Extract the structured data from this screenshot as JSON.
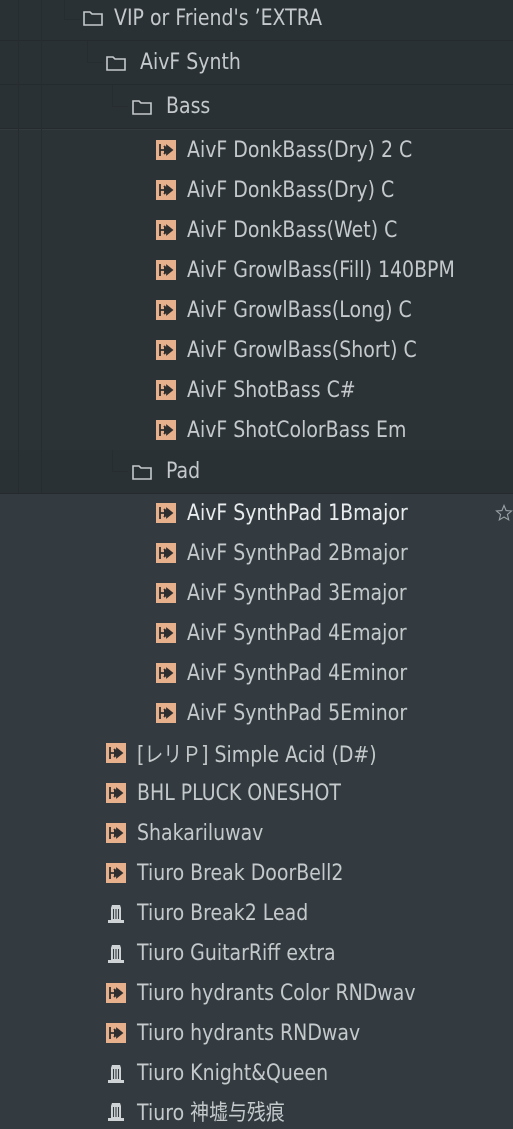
{
  "tree": {
    "folders": {
      "vip": "VIP or Friend's ’EXTRA",
      "aivf_synth": "AivF Synth",
      "bass": "Bass",
      "pad": "Pad"
    },
    "bass_items": [
      "AivF DonkBass(Dry) 2 C",
      "AivF DonkBass(Dry) C",
      "AivF DonkBass(Wet) C",
      "AivF GrowlBass(Fill) 140BPM",
      "AivF GrowlBass(Long) C",
      "AivF GrowlBass(Short) C",
      "AivF ShotBass  C#",
      "AivF ShotColorBass  Em"
    ],
    "pad_items": [
      "AivF SynthPad 1Bmajor",
      "AivF SynthPad 2Bmajor",
      "AivF SynthPad 3Emajor",
      "AivF SynthPad 4Emajor",
      "AivF SynthPad 4Eminor",
      "AivF SynthPad 5Eminor"
    ],
    "root_items": [
      {
        "label": "[レリＰ] Simple Acid (D#)",
        "icon": "sample-icon"
      },
      {
        "label": "BHL PLUCK ONESHOT",
        "icon": "sample-icon"
      },
      {
        "label": "Shakariluwav",
        "icon": "sample-icon"
      },
      {
        "label": "Tiuro Break DoorBell2",
        "icon": "sample-icon"
      },
      {
        "label": "Tiuro Break2 Lead",
        "icon": "plugin-preset-icon"
      },
      {
        "label": "Tiuro GuitarRiff extra",
        "icon": "plugin-preset-icon"
      },
      {
        "label": "Tiuro hydrants Color RNDwav",
        "icon": "sample-icon"
      },
      {
        "label": "Tiuro hydrants RNDwav",
        "icon": "sample-icon"
      },
      {
        "label": "Tiuro Knight&Queen",
        "icon": "plugin-preset-icon"
      },
      {
        "label": "Tiuro 神墟与残痕",
        "icon": "plugin-preset-icon"
      }
    ]
  },
  "colors": {
    "background": "#333b40",
    "folder_band": "#2a3135",
    "text": "#c4c9cc",
    "sample_icon_bg": "#e7b08c",
    "sample_icon_fg": "#2f2f2f",
    "knob_icon": "#cfd3d5"
  }
}
